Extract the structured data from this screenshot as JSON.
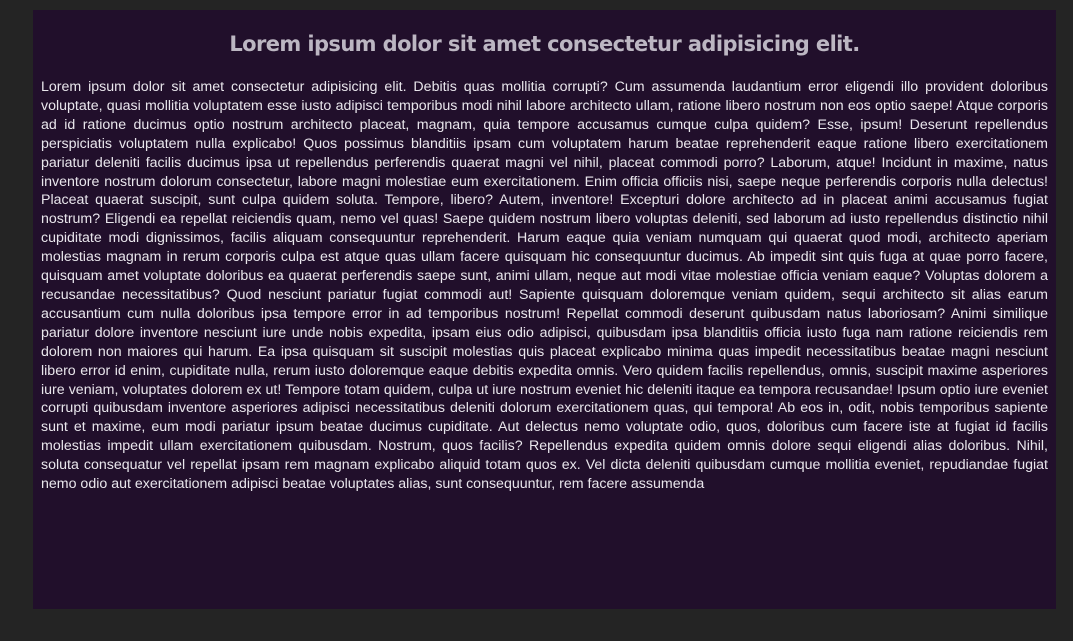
{
  "article": {
    "title": "Lorem ipsum dolor sit amet consectetur adipisicing elit.",
    "body": "Lorem ipsum dolor sit amet consectetur adipisicing elit. Debitis quas mollitia corrupti? Cum assumenda laudantium error eligendi illo provident doloribus voluptate, quasi mollitia voluptatem esse iusto adipisci temporibus modi nihil labore architecto ullam, ratione libero nostrum non eos optio saepe! Atque corporis ad id ratione ducimus optio nostrum architecto placeat, magnam, quia tempore accusamus cumque culpa quidem? Esse, ipsum! Deserunt repellendus perspiciatis voluptatem nulla explicabo! Quos possimus blanditiis ipsam cum voluptatem harum beatae reprehenderit eaque ratione libero exercitationem pariatur deleniti facilis ducimus ipsa ut repellendus perferendis quaerat magni vel nihil, placeat commodi porro? Laborum, atque! Incidunt in maxime, natus inventore nostrum dolorum consectetur, labore magni molestiae eum exercitationem. Enim officia officiis nisi, saepe neque perferendis corporis nulla delectus! Placeat quaerat suscipit, sunt culpa quidem soluta. Tempore, libero? Autem, inventore! Excepturi dolore architecto ad in placeat animi accusamus fugiat nostrum? Eligendi ea repellat reiciendis quam, nemo vel quas! Saepe quidem nostrum libero voluptas deleniti, sed laborum ad iusto repellendus distinctio nihil cupiditate modi dignissimos, facilis aliquam consequuntur reprehenderit. Harum eaque quia veniam numquam qui quaerat quod modi, architecto aperiam molestias magnam in rerum corporis culpa est atque quas ullam facere quisquam hic consequuntur ducimus. Ab impedit sint quis fuga at quae porro facere, quisquam amet voluptate doloribus ea quaerat perferendis saepe sunt, animi ullam, neque aut modi vitae molestiae officia veniam eaque? Voluptas dolorem a recusandae necessitatibus? Quod nesciunt pariatur fugiat commodi aut! Sapiente quisquam doloremque veniam quidem, sequi architecto sit alias earum accusantium cum nulla doloribus ipsa tempore error in ad temporibus nostrum! Repellat commodi deserunt quibusdam natus laboriosam? Animi similique pariatur dolore inventore nesciunt iure unde nobis expedita, ipsam eius odio adipisci, quibusdam ipsa blanditiis officia iusto fuga nam ratione reiciendis rem dolorem non maiores qui harum. Ea ipsa quisquam sit suscipit molestias quis placeat explicabo minima quas impedit necessitatibus beatae magni nesciunt libero error id enim, cupiditate nulla, rerum iusto doloremque eaque debitis expedita omnis. Vero quidem facilis repellendus, omnis, suscipit maxime asperiores iure veniam, voluptates dolorem ex ut! Tempore totam quidem, culpa ut iure nostrum eveniet hic deleniti itaque ea tempora recusandae! Ipsum optio iure eveniet corrupti quibusdam inventore asperiores adipisci necessitatibus deleniti dolorum exercitationem quas, qui tempora! Ab eos in, odit, nobis temporibus sapiente sunt et maxime, eum modi pariatur ipsum beatae ducimus cupiditate. Aut delectus nemo voluptate odio, quos, doloribus cum facere iste at fugiat id facilis molestias impedit ullam exercitationem quibusdam. Nostrum, quos facilis? Repellendus expedita quidem omnis dolore sequi eligendi alias doloribus. Nihil, soluta consequatur vel repellat ipsam rem magnam explicabo aliquid totam quos ex. Vel dicta deleniti quibusdam cumque mollitia eveniet, repudiandae fugiat nemo odio aut exercitationem adipisci beatae voluptates alias, sunt consequuntur, rem facere assumenda"
  },
  "colors": {
    "page_background": "#242424",
    "panel_background": "#210f2b",
    "title_text": "#bcb6c2",
    "body_text": "#e9e6ec"
  }
}
